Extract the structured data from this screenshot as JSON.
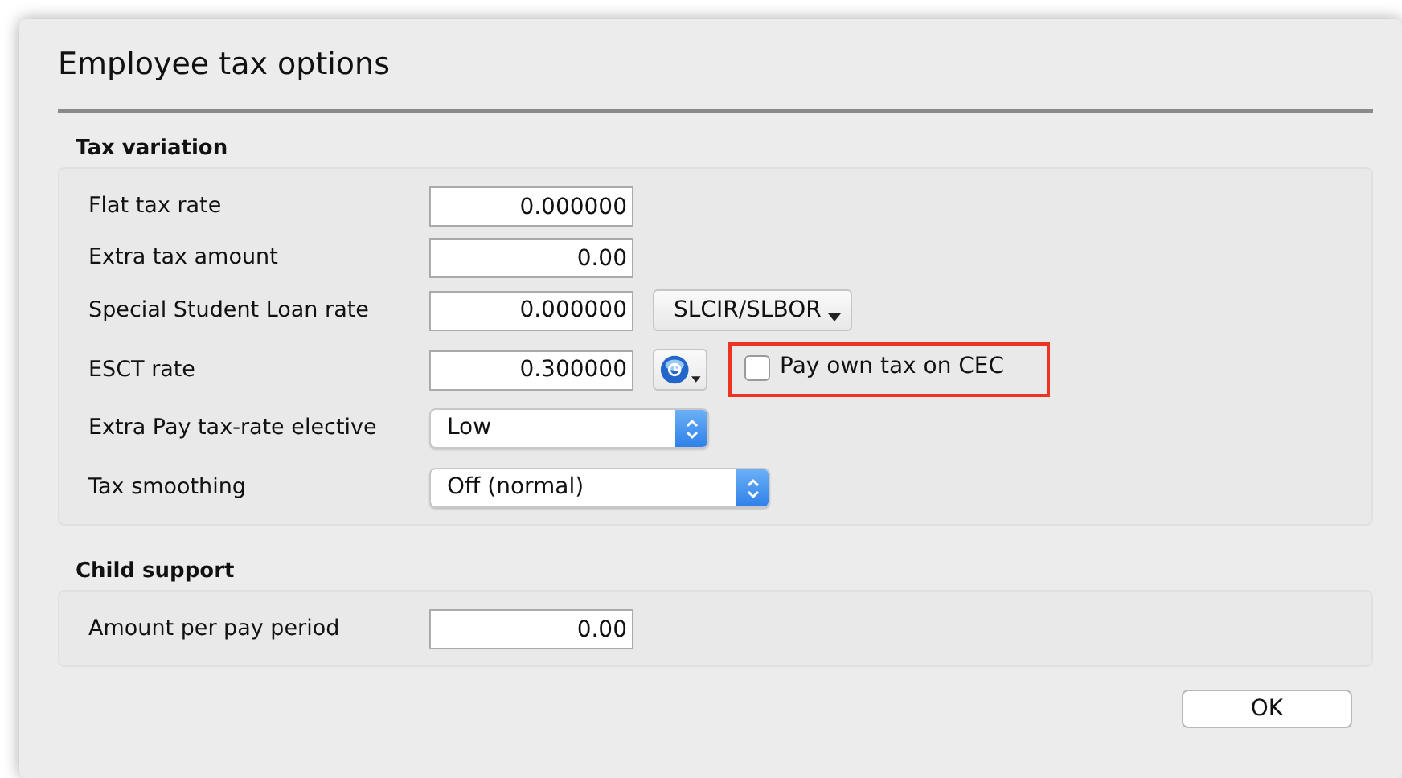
{
  "window": {
    "title": "Employee tax options"
  },
  "sections": [
    {
      "heading": "Tax variation",
      "rows": [
        {
          "kind": "field",
          "label": "Flat tax rate",
          "value": "0.000000"
        },
        {
          "kind": "field",
          "label": "Extra tax amount",
          "value": "0.00"
        },
        {
          "kind": "field",
          "label": "Special Student Loan rate",
          "value": "0.000000",
          "menu_button": "SLCIR/SLBOR"
        },
        {
          "kind": "field",
          "label": "ESCT rate",
          "value": "0.300000",
          "icon_menu": true,
          "checkbox": {
            "label": "Pay own tax on CEC",
            "checked": false,
            "highlighted": true
          }
        },
        {
          "kind": "select",
          "label": "Extra Pay tax-rate elective",
          "value": "Low"
        },
        {
          "kind": "select",
          "label": "Tax smoothing",
          "value": "Off (normal)",
          "wide": true
        }
      ]
    },
    {
      "heading": "Child support",
      "rows": [
        {
          "kind": "field",
          "label": "Amount per pay period",
          "value": "0.00"
        }
      ]
    }
  ],
  "buttons": [
    {
      "label": "OK"
    }
  ]
}
